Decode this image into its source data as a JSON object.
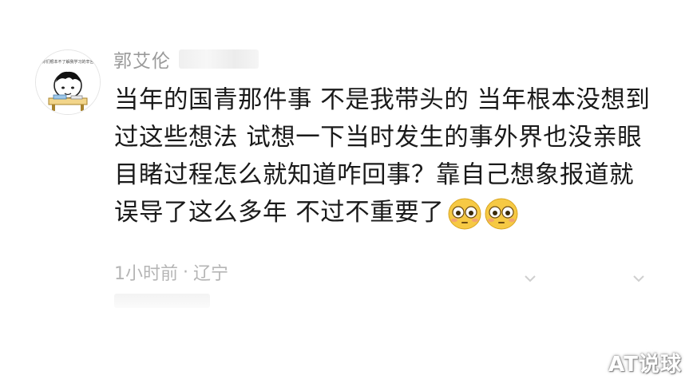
{
  "comment": {
    "username": "郭艾伦",
    "lines": [
      "当年的国青那件事 不是我带头的 当年根本没想到",
      "过这些想法 试想一下当时发生的事外界也没亲眼",
      "目睹过程怎么就知道咋回事？靠自己想象报道就",
      "误导了这么多年  不过不重要了"
    ],
    "emojis": [
      "flushed-face-icon",
      "flushed-face-icon"
    ],
    "time": "1小时前",
    "location": "辽宁",
    "avatar_caption": "你们根本不了解我学习的辛苦"
  },
  "watermark": "AT说球",
  "colors": {
    "text": "#1a1a1a",
    "username": "#9a9a9a",
    "meta": "#b5b5b5",
    "emoji_face": "#f6c944"
  }
}
